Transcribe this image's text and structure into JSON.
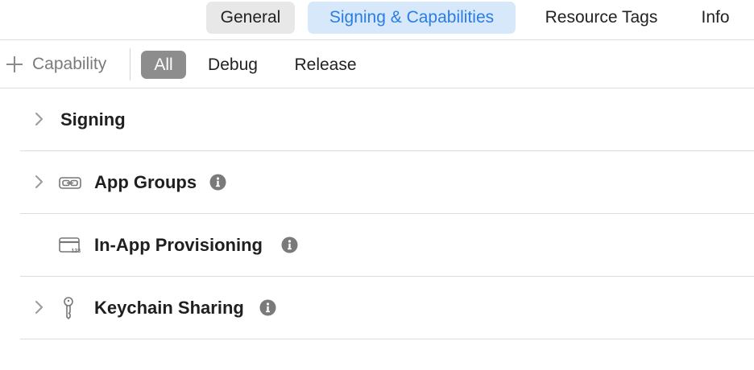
{
  "tabs": [
    {
      "label": "General",
      "selected": false
    },
    {
      "label": "Signing & Capabilities",
      "selected": true
    },
    {
      "label": "Resource Tags",
      "selected": false
    },
    {
      "label": "Info",
      "selected": false
    }
  ],
  "filter_bar": {
    "add_capability_label": "Capability",
    "add_icon": "plus-icon",
    "filters": [
      {
        "label": "All",
        "selected": true
      },
      {
        "label": "Debug",
        "selected": false
      },
      {
        "label": "Release",
        "selected": false
      }
    ]
  },
  "capabilities": [
    {
      "title": "Signing",
      "expandable": true,
      "icon": null,
      "info": false
    },
    {
      "title": "App Groups",
      "expandable": true,
      "icon": "link-icon",
      "info": true
    },
    {
      "title": "In-App Provisioning",
      "expandable": false,
      "icon": "card-icon",
      "info": true
    },
    {
      "title": "Keychain Sharing",
      "expandable": true,
      "icon": "key-icon",
      "info": true
    }
  ],
  "colors": {
    "accent": "#2a7de1",
    "selected_tab_bg": "#d7e8fb",
    "selected_filter_bg": "#8d8d8d",
    "divider": "#dcdcdc"
  }
}
